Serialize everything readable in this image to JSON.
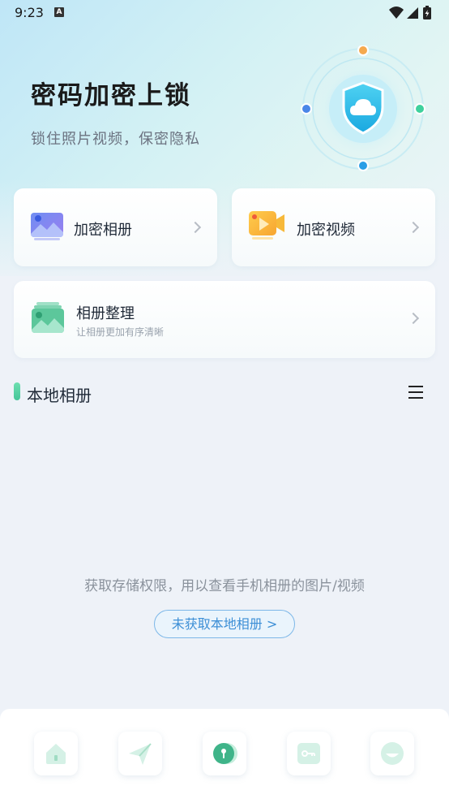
{
  "status_bar": {
    "time": "9:23",
    "indicator": "A",
    "icons": [
      "wifi-icon",
      "signal-icon",
      "battery-charging-icon"
    ]
  },
  "hero": {
    "title": "密码加密上锁",
    "subtitle": "锁住照片视频，保密隐私",
    "illustration": "cloud-shield-icon"
  },
  "cards": {
    "album": {
      "label": "加密相册",
      "icon": "photo-album-icon"
    },
    "video": {
      "label": "加密视频",
      "icon": "video-camera-icon"
    },
    "organize": {
      "label": "相册整理",
      "sublabel": "让相册更加有序清晰",
      "icon": "stacked-photos-icon"
    }
  },
  "section": {
    "title": "本地相册",
    "menu_icon": "menu-icon"
  },
  "empty_state": {
    "message": "获取存储权限，用以查看手机相册的图片/视频",
    "button_label": "未获取本地相册 >"
  },
  "bottom_nav": {
    "items": [
      {
        "name": "home",
        "icon": "home-icon"
      },
      {
        "name": "send",
        "icon": "paper-plane-icon"
      },
      {
        "name": "lock",
        "icon": "lock-icon",
        "active": true
      },
      {
        "name": "key",
        "icon": "key-icon"
      },
      {
        "name": "profile",
        "icon": "smile-icon"
      }
    ]
  },
  "colors": {
    "accent_green": "#45c59a",
    "accent_blue": "#3d8fd6",
    "shield_blue": "#2bb6e8"
  }
}
